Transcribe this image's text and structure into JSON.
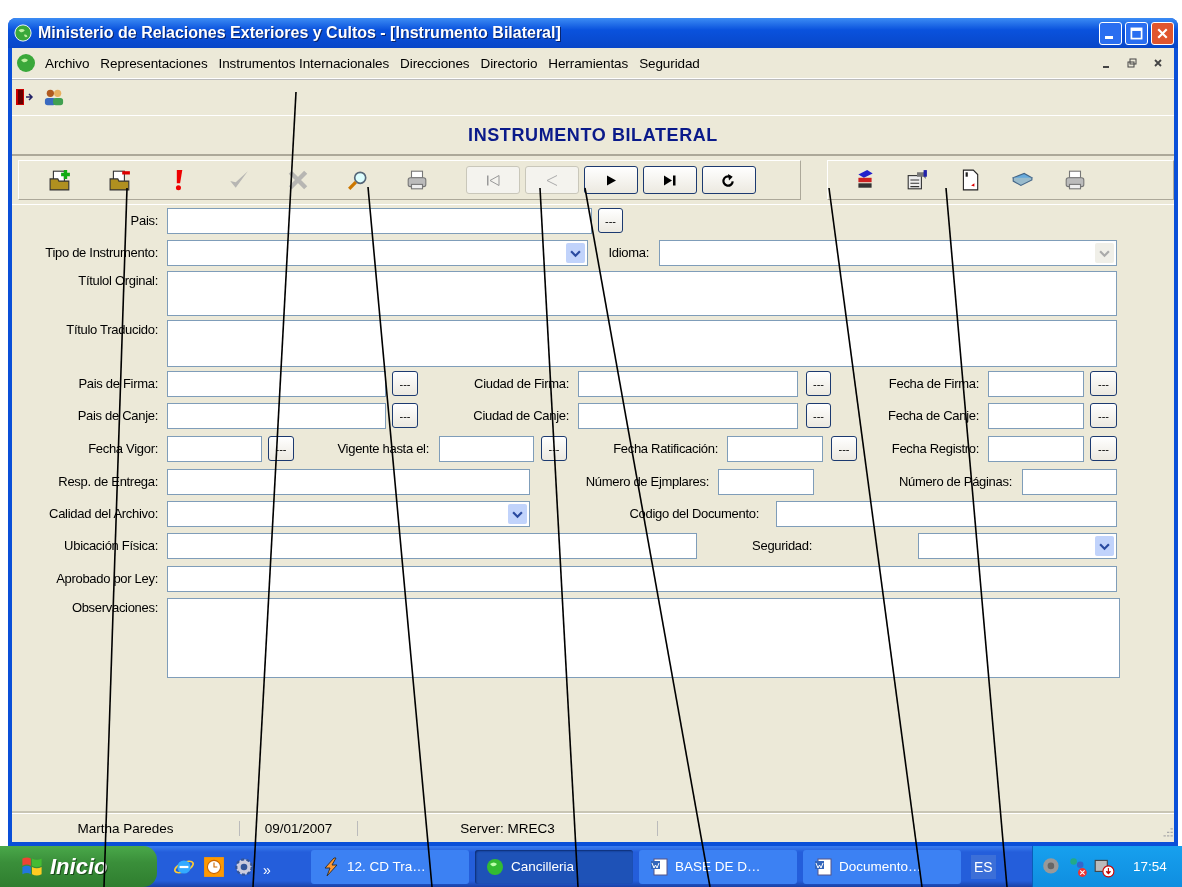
{
  "window": {
    "title": "Ministerio de Relaciones Exteriores y Cultos - [Instrumento Bilateral]"
  },
  "menu": [
    "Archivo",
    "Representaciones",
    "Instrumentos Internacionales",
    "Direcciones",
    "Directorio",
    "Herramientas",
    "Seguridad"
  ],
  "heading": "INSTRUMENTO BILATERAL",
  "toolbar": [
    {
      "disabled": false
    },
    {
      "disabled": false
    },
    {
      "disabled": false
    },
    {
      "disabled": true
    },
    {
      "disabled": true
    },
    {
      "disabled": false
    },
    {
      "disabled": false
    }
  ],
  "navigation": [
    {
      "disabled": true
    },
    {
      "disabled": true
    },
    {
      "disabled": false
    },
    {
      "disabled": false
    },
    {
      "disabled": false
    }
  ],
  "report_toolbar": [
    {
      "disabled": false
    },
    {
      "disabled": false
    },
    {
      "disabled": false
    },
    {
      "disabled": false
    },
    {
      "disabled": false
    }
  ],
  "form": [
    [
      {
        "kind": "label",
        "text": "Pais:"
      },
      {
        "kind": "field"
      },
      {
        "kind": "lookup",
        "text": "---"
      }
    ],
    [
      {
        "kind": "label",
        "text": "Tipo de Instrumento:"
      },
      {
        "kind": "combo",
        "disabled": false
      },
      {
        "kind": "label",
        "text": "Idioma:"
      },
      {
        "kind": "combo",
        "disabled": true
      }
    ],
    [
      {
        "kind": "label",
        "text": "Títulol Orginal:"
      },
      {
        "kind": "memo"
      }
    ],
    [
      {
        "kind": "label",
        "text": "Título Traducido:"
      },
      {
        "kind": "memo"
      }
    ],
    [
      {
        "kind": "label",
        "text": "Pais de Firma:"
      },
      {
        "kind": "field"
      },
      {
        "kind": "lookup",
        "text": "---"
      },
      {
        "kind": "label",
        "text": "Ciudad de Firma:"
      },
      {
        "kind": "field"
      },
      {
        "kind": "lookup",
        "text": "---"
      },
      {
        "kind": "label",
        "text": "Fecha de Firma:"
      },
      {
        "kind": "field"
      },
      {
        "kind": "lookup",
        "text": "---"
      }
    ],
    [
      {
        "kind": "label",
        "text": "Pais de Canje:"
      },
      {
        "kind": "field"
      },
      {
        "kind": "lookup",
        "text": "---"
      },
      {
        "kind": "label",
        "text": "Ciudad de Canje:"
      },
      {
        "kind": "field"
      },
      {
        "kind": "lookup",
        "text": "---"
      },
      {
        "kind": "label",
        "text": "Fecha de Canje:"
      },
      {
        "kind": "field"
      },
      {
        "kind": "lookup",
        "text": "---"
      }
    ],
    [
      {
        "kind": "label",
        "text": "Fecha Vigor:"
      },
      {
        "kind": "field"
      },
      {
        "kind": "lookup",
        "text": "---"
      },
      {
        "kind": "label",
        "text": "Vigente hasta el:"
      },
      {
        "kind": "field"
      },
      {
        "kind": "lookup",
        "text": "---"
      },
      {
        "kind": "label",
        "text": "Fecha Ratificación:"
      },
      {
        "kind": "field"
      },
      {
        "kind": "lookup",
        "text": "---"
      },
      {
        "kind": "label",
        "text": "Fecha Registro:"
      },
      {
        "kind": "field"
      },
      {
        "kind": "lookup",
        "text": "---"
      }
    ],
    [
      {
        "kind": "label",
        "text": "Resp. de Entrega:"
      },
      {
        "kind": "field"
      },
      {
        "kind": "label",
        "text": "Número de Ejmplares:"
      },
      {
        "kind": "field"
      },
      {
        "kind": "label",
        "text": "Número de Páginas:"
      },
      {
        "kind": "field"
      }
    ],
    [
      {
        "kind": "label",
        "text": "Calidad del Archivo:"
      },
      {
        "kind": "combo",
        "disabled": false
      },
      {
        "kind": "label",
        "text": "Codigo del Documento:"
      },
      {
        "kind": "field"
      }
    ],
    [
      {
        "kind": "label",
        "text": "Ubicación Física:"
      },
      {
        "kind": "field"
      },
      {
        "kind": "label",
        "text": "Seguridad:"
      },
      {
        "kind": "combo",
        "disabled": false
      }
    ],
    [
      {
        "kind": "label",
        "text": "Aprobado por Ley:"
      },
      {
        "kind": "field"
      }
    ],
    [
      {
        "kind": "label",
        "text": "Observaciones:"
      },
      {
        "kind": "memo"
      }
    ]
  ],
  "status_bar": [
    "Martha Paredes",
    "09/01/2007",
    "Server: MREC3"
  ],
  "taskbar": {
    "start": "Inicio",
    "chevron": "»",
    "tasks": [
      {
        "label": "12. CD Tra…",
        "selected": false
      },
      {
        "label": "Cancilleria",
        "selected": true
      },
      {
        "label": "BASE DE D…",
        "selected": false
      },
      {
        "label": "Documento…",
        "selected": false
      }
    ],
    "language": "ES",
    "clock": "17:54"
  }
}
